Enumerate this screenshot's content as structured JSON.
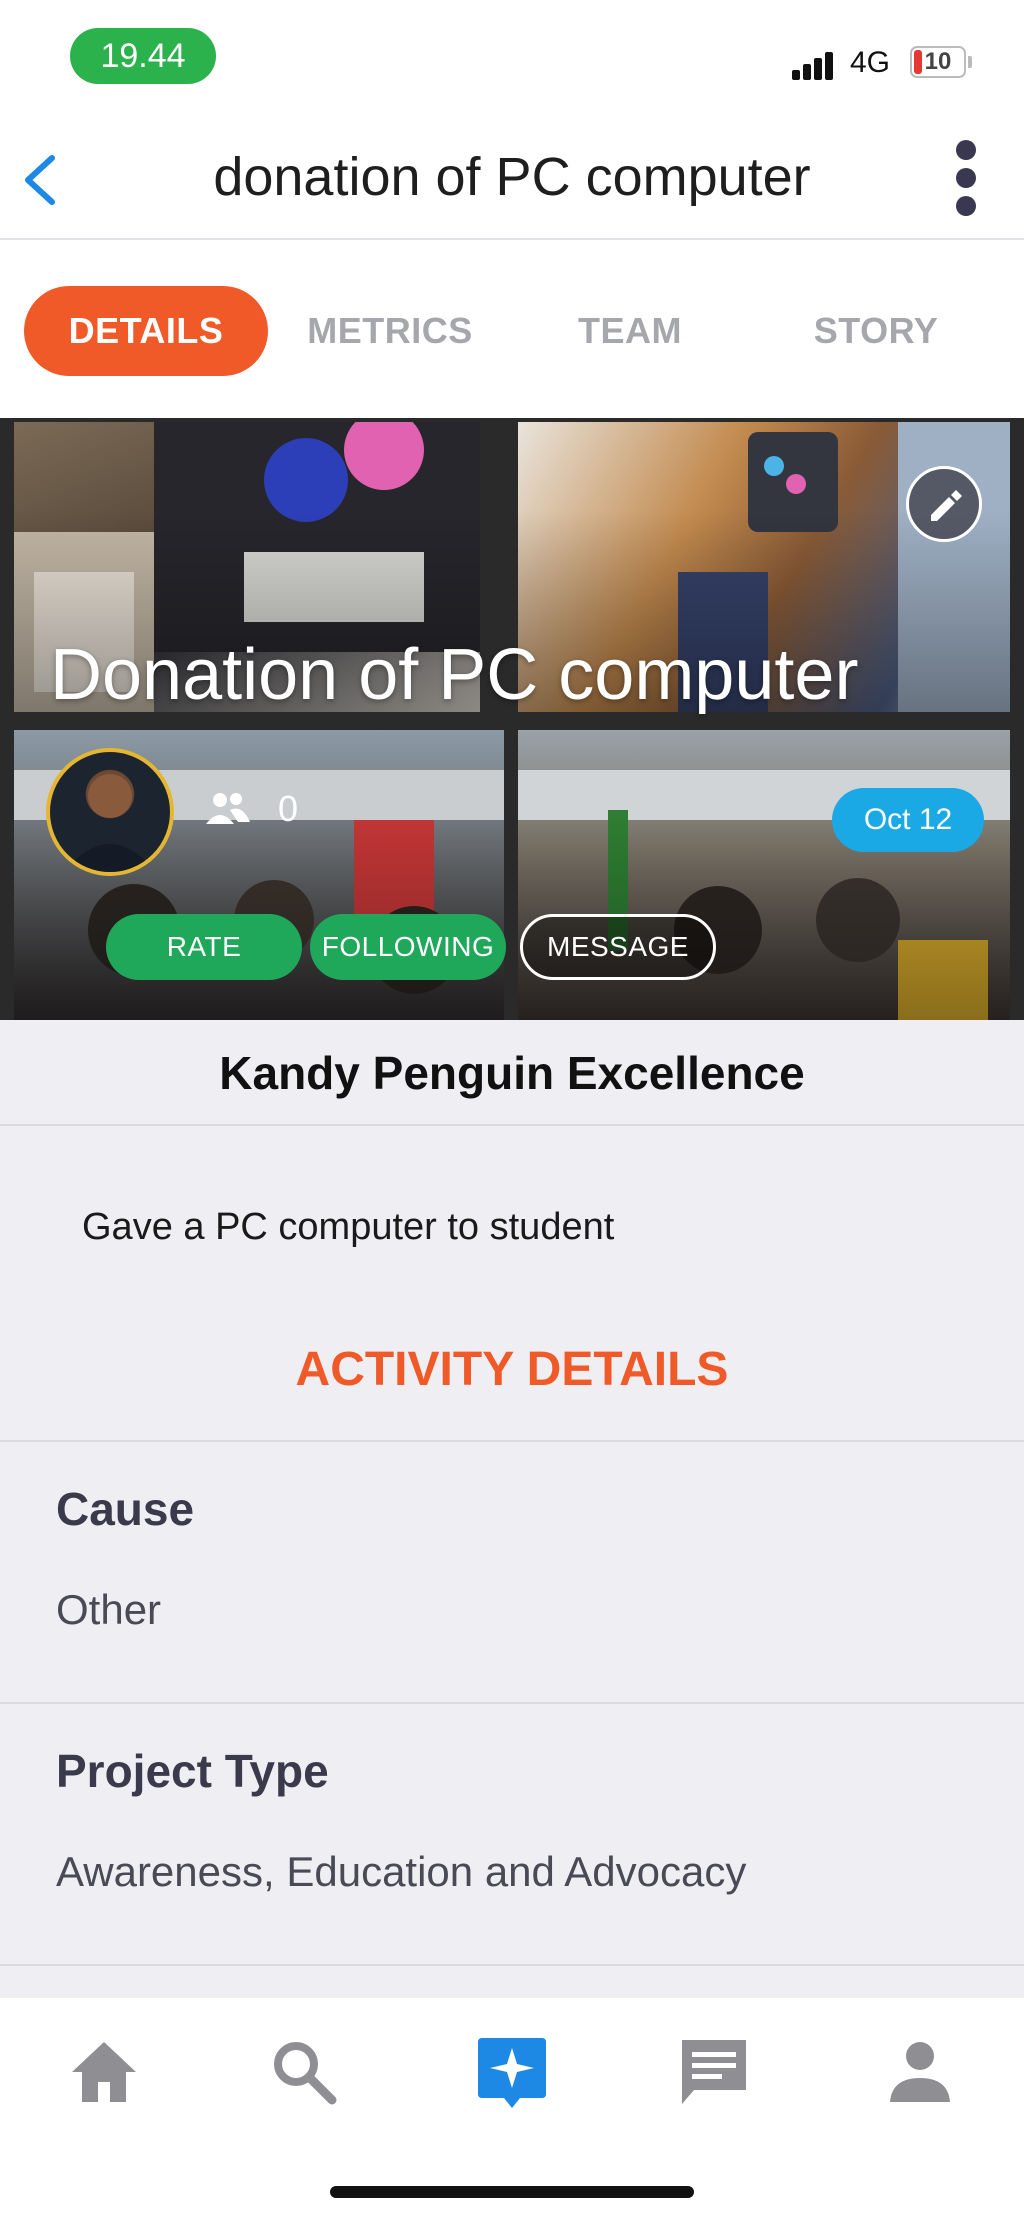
{
  "status_bar": {
    "time": "19.44",
    "network": "4G",
    "battery_level": "10"
  },
  "header": {
    "title": "donation of PC computer"
  },
  "tabs": [
    {
      "label": "DETAILS",
      "active": true
    },
    {
      "label": "METRICS",
      "active": false
    },
    {
      "label": "TEAM",
      "active": false
    },
    {
      "label": "STORY",
      "active": false
    }
  ],
  "hero": {
    "title": "Donation of PC computer",
    "follower_count": "0",
    "date": "Oct 12",
    "buttons": {
      "rate": "RATE",
      "following": "FOLLOWING",
      "message": "MESSAGE"
    }
  },
  "details": {
    "organization": "Kandy Penguin Excellence",
    "description": "Gave a PC computer to student",
    "section_title": "ACTIVITY DETAILS",
    "fields": [
      {
        "label": "Cause",
        "value": "Other"
      },
      {
        "label": "Project Type",
        "value": "Awareness, Education and Advocacy"
      }
    ]
  },
  "bottom_nav": [
    {
      "icon": "home-icon",
      "active": false
    },
    {
      "icon": "search-icon",
      "active": false
    },
    {
      "icon": "activity-icon",
      "active": true
    },
    {
      "icon": "messages-icon",
      "active": false
    },
    {
      "icon": "profile-icon",
      "active": false
    }
  ],
  "colors": {
    "accent": "#f05a28",
    "active_nav": "#1e88e5",
    "green": "#1fa85a",
    "date_badge": "#1ba9e6",
    "status_pill": "#2bb24c"
  }
}
